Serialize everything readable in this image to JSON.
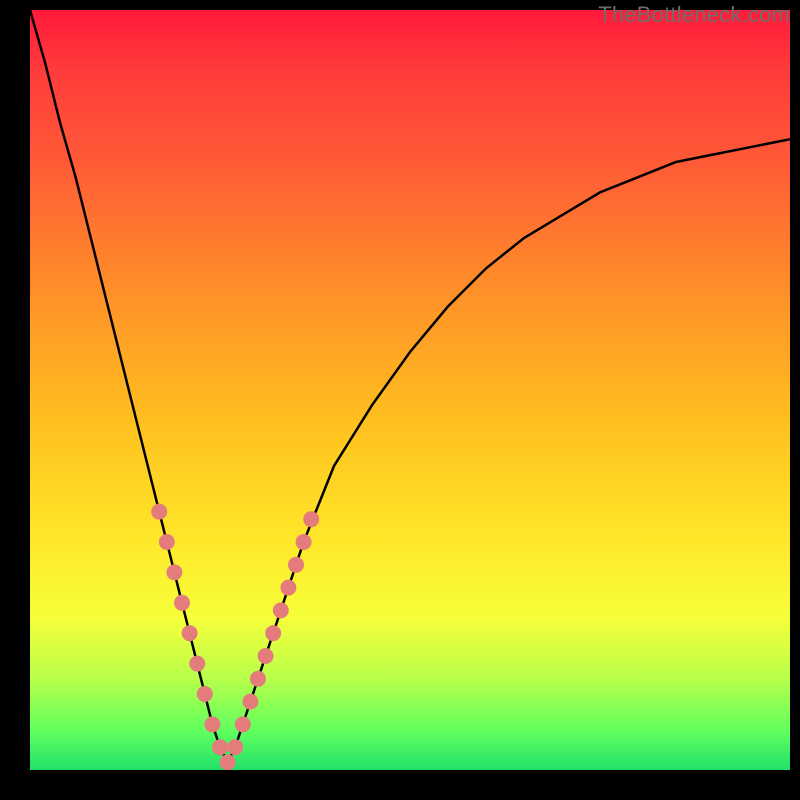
{
  "watermark": "TheBottleneck.com",
  "colors": {
    "dot": "#e47c7c",
    "curve": "#000000",
    "gradient_stops": [
      "#ff1a3a",
      "#ff3b3b",
      "#ff5a36",
      "#ff8a2a",
      "#ffc21f",
      "#ffe82a",
      "#f6ff3a",
      "#b8ff4a",
      "#5eff5e",
      "#22e06a"
    ]
  },
  "chart_data": {
    "type": "line",
    "title": "",
    "xlabel": "",
    "ylabel": "",
    "xlim": [
      0,
      100
    ],
    "ylim": [
      0,
      100
    ],
    "grid": false,
    "legend": false,
    "note": "V-shaped bottleneck curve; minimum near x≈26. Background color gradient encodes y-value (red=high, green=low). Salmon dots mark sampled points along the curve near the minimum.",
    "series": [
      {
        "name": "curve",
        "x": [
          0,
          2,
          4,
          6,
          8,
          10,
          12,
          14,
          16,
          18,
          20,
          22,
          24,
          25,
          26,
          27,
          28,
          30,
          32,
          34,
          36,
          38,
          40,
          45,
          50,
          55,
          60,
          65,
          70,
          75,
          80,
          85,
          90,
          95,
          100
        ],
        "values": [
          100,
          93,
          85,
          78,
          70,
          62,
          54,
          46,
          38,
          30,
          22,
          14,
          6,
          3,
          1,
          3,
          6,
          12,
          18,
          24,
          30,
          35,
          40,
          48,
          55,
          61,
          66,
          70,
          73,
          76,
          78,
          80,
          81,
          82,
          83
        ]
      }
    ],
    "dots": {
      "name": "sample-points",
      "x": [
        17,
        18,
        19,
        20,
        21,
        22,
        23,
        24,
        25,
        26,
        27,
        28,
        29,
        30,
        31,
        32,
        33,
        34,
        35,
        36,
        37
      ],
      "values": [
        34,
        30,
        26,
        22,
        18,
        14,
        10,
        6,
        3,
        1,
        3,
        6,
        9,
        12,
        15,
        18,
        21,
        24,
        27,
        30,
        33
      ]
    }
  }
}
